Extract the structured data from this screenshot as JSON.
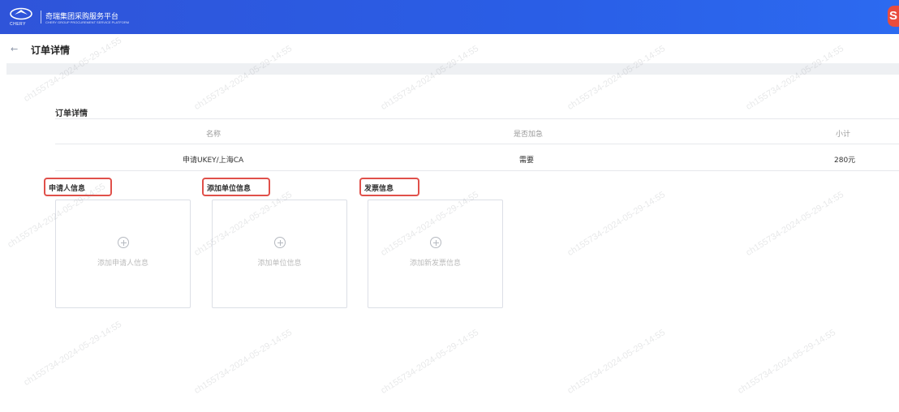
{
  "header": {
    "logo_text": "CHERY",
    "brand_title": "奇瑞集团采购服务平台",
    "brand_subtitle": "CHERY GROUP PROCUREMENT SERVICE PLATFORM"
  },
  "subheader": {
    "back_icon": "←",
    "title": "订单详情"
  },
  "order": {
    "section_title": "订单详情",
    "columns": [
      "名称",
      "是否加急",
      "小计"
    ],
    "row": {
      "name": "申请UKEY/上海CA",
      "urgent": "需要",
      "subtotal": "280元"
    }
  },
  "sections": {
    "applicant": {
      "label": "申请人信息",
      "add_text": "添加申请人信息"
    },
    "company": {
      "label": "添加单位信息",
      "add_text": "添加单位信息"
    },
    "invoice": {
      "label": "发票信息",
      "add_text": "添加新发票信息"
    }
  },
  "watermark": "ch155734-2024-05-29-14:55",
  "colors": {
    "header_blue": "#2a5ee6",
    "highlight_red": "#e0504a"
  }
}
